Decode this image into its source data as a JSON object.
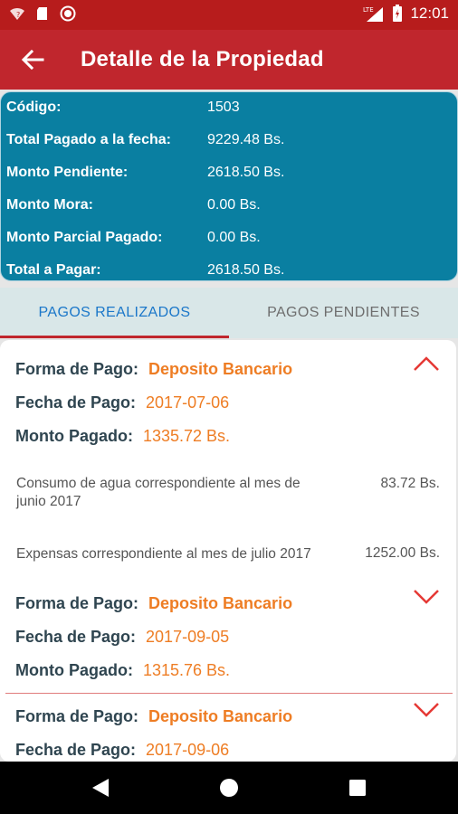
{
  "status_bar": {
    "time": "12:01",
    "network": "LTE"
  },
  "app_bar": {
    "title": "Detalle de la Propiedad"
  },
  "summary": [
    {
      "label": "Código:",
      "value": "1503"
    },
    {
      "label": "Total Pagado a la fecha:",
      "value": "9229.48 Bs."
    },
    {
      "label": "Monto Pendiente:",
      "value": "2618.50 Bs."
    },
    {
      "label": "Monto Mora:",
      "value": "0.00 Bs."
    },
    {
      "label": "Monto Parcial Pagado:",
      "value": "0.00 Bs."
    },
    {
      "label": "Total a Pagar:",
      "value": "2618.50 Bs."
    }
  ],
  "tabs": [
    {
      "label": "PAGOS REALIZADOS"
    },
    {
      "label": "PAGOS PENDIENTES"
    }
  ],
  "labels": {
    "forma": "Forma de Pago:",
    "fecha": "Fecha de Pago:",
    "monto": "Monto Pagado:"
  },
  "payments": [
    {
      "forma": "Deposito Bancario",
      "fecha": "2017-07-06",
      "monto": "1335.72 Bs.",
      "expanded": true,
      "details": [
        {
          "desc": "Consumo de agua correspondiente al mes de junio 2017",
          "amount": "83.72 Bs."
        },
        {
          "desc": "Expensas correspondiente al mes de julio 2017",
          "amount": "1252.00 Bs."
        }
      ]
    },
    {
      "forma": "Deposito Bancario",
      "fecha": "2017-09-05",
      "monto": "1315.76 Bs.",
      "expanded": false
    },
    {
      "forma": "Deposito Bancario",
      "fecha": "2017-09-06",
      "monto": "",
      "expanded": false
    }
  ],
  "colors": {
    "primary": "#c0262d",
    "summary_bg": "#0a7fa1",
    "value_orange": "#ee7d24",
    "tab_active": "#1b77c9"
  }
}
